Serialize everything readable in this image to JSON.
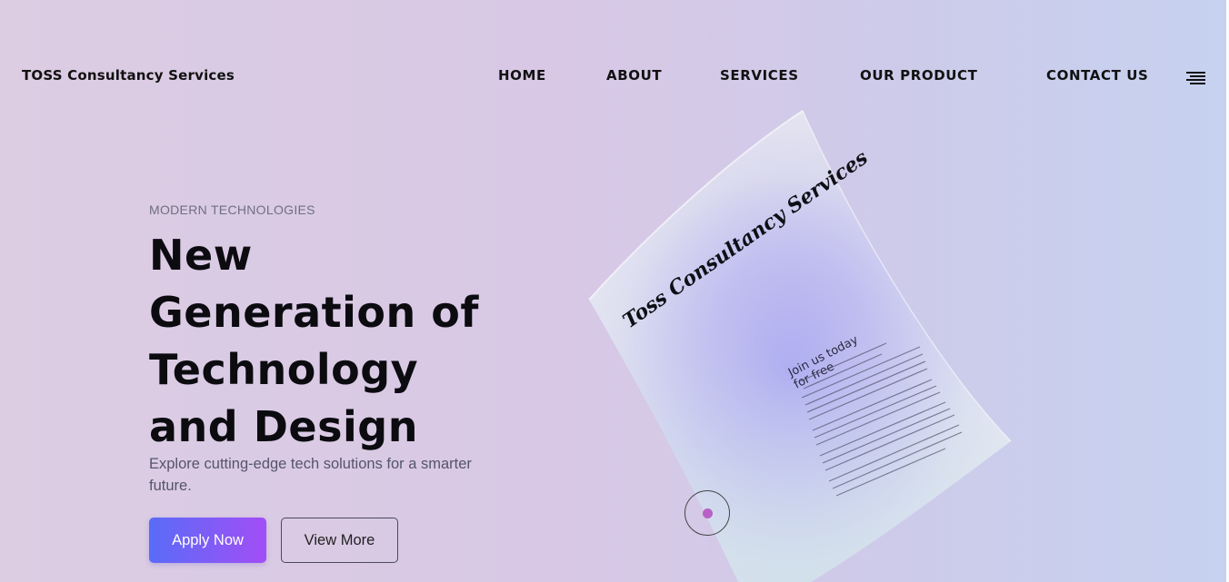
{
  "header": {
    "brand": "TOSS Consultancy Services",
    "nav": [
      "HOME",
      "ABOUT",
      "SERVICES",
      "OUR PRODUCT",
      "CONTACT US"
    ],
    "menu_icon": "hamburger-menu-icon"
  },
  "hero": {
    "eyebrow": "MODERN TECHNOLOGIES",
    "headline_lines": [
      "New",
      "Generation of",
      "Technology",
      "and Design"
    ],
    "subtext": "Explore cutting-edge tech solutions for a smarter future.",
    "apply_label": "Apply Now",
    "view_label": "View More"
  },
  "paper": {
    "title": "Toss Consultancy Services",
    "heading_line1": "Join us today",
    "heading_line2": "for free"
  },
  "colors": {
    "accent_start": "#5a6cf7",
    "accent_end": "#a24ef6",
    "play_dot": "#b761c6"
  }
}
